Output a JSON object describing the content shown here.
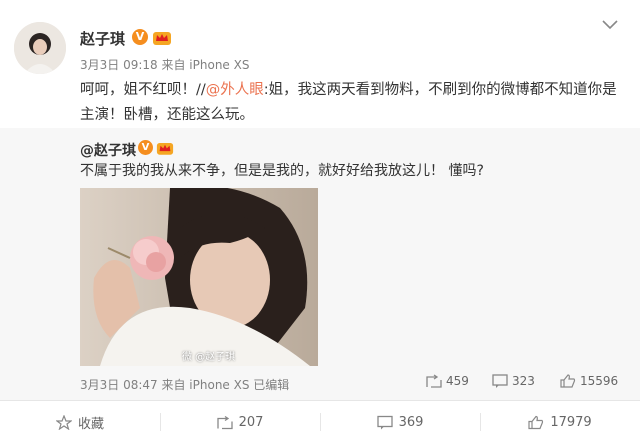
{
  "post": {
    "author": "赵子琪",
    "meta": "3月3日 09:18 来自 iPhone XS",
    "text_before": "呵呵，姐不红呗！//",
    "mention": "@外人眼",
    "text_after": ":姐，我这两天看到物料，不刷到你的微博都不知道你是主演！卧槽，还能这么玩。"
  },
  "repost": {
    "author": "@赵子琪",
    "text": "不属于我的我从来不争，但是是我的，就好好给我放这儿！ 懂吗?",
    "watermark": "微 @赵子琪",
    "meta": "3月3日 08:47 来自 iPhone XS   已编辑",
    "reposts": "459",
    "comments": "323",
    "likes": "15596"
  },
  "actions": {
    "favorite_label": "收藏",
    "repost_count": "207",
    "comment_count": "369",
    "like_count": "17979"
  },
  "colors": {
    "accent": "#eb7350",
    "verified": "#f58e1f"
  },
  "icons": [
    "chevron-down-icon",
    "verified-icon",
    "crown-icon",
    "repost-icon",
    "comment-icon",
    "like-icon",
    "star-icon"
  ]
}
